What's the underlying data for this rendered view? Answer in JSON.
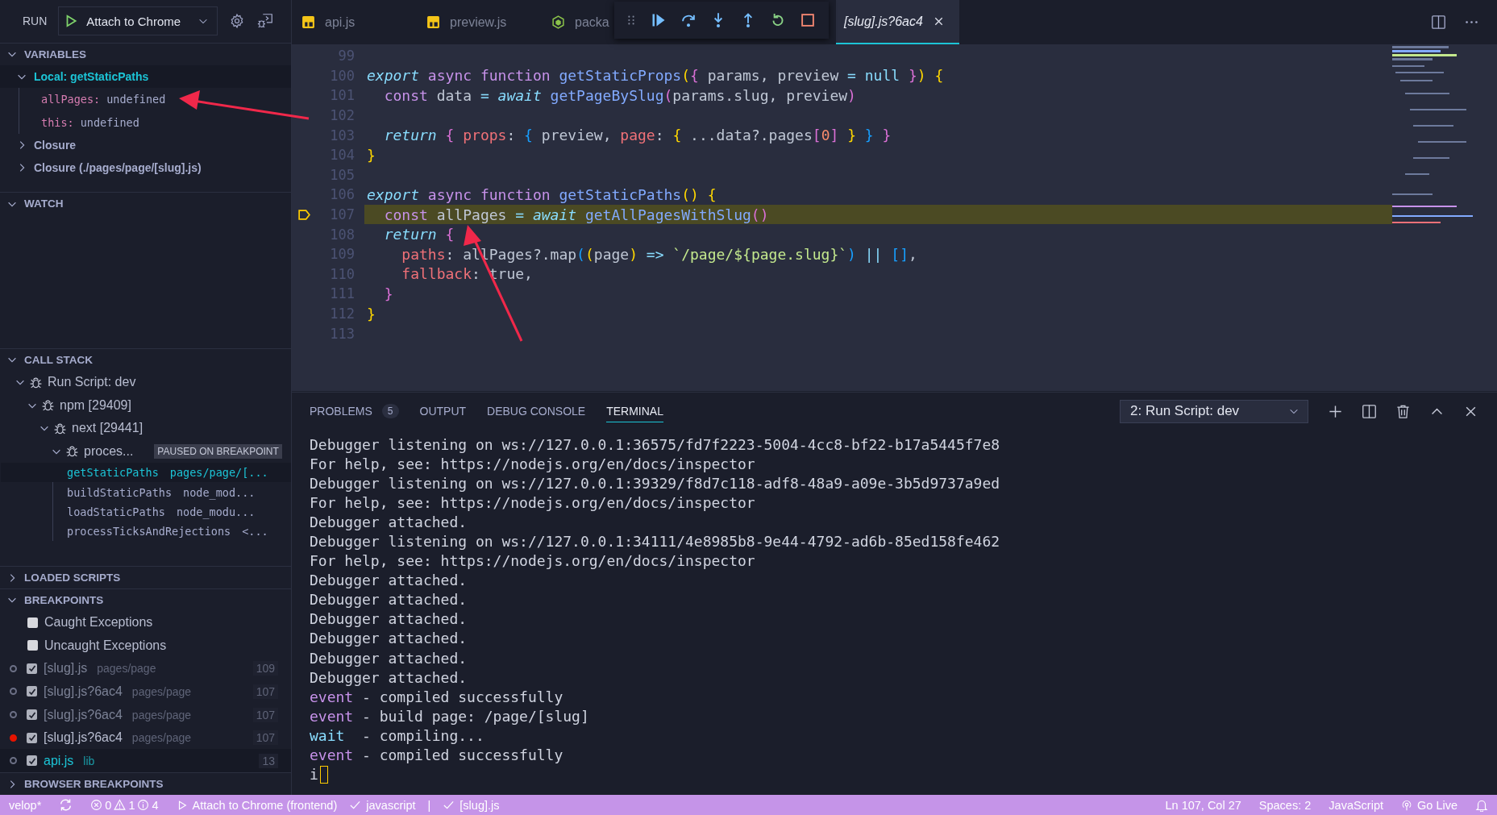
{
  "sidebar": {
    "run": {
      "label": "RUN",
      "configuration": "Attach to Chrome"
    },
    "variables": {
      "title": "VARIABLES",
      "expanded": true,
      "scopes": [
        {
          "label": "Local: getStaticPaths",
          "expanded": true,
          "selected": true,
          "variables": [
            {
              "name": "allPages:",
              "value": "undefined"
            },
            {
              "name": "this:",
              "value": "undefined"
            }
          ]
        },
        {
          "label": "Closure",
          "expanded": false,
          "selected": false
        },
        {
          "label": "Closure (./pages/page/[slug].js)",
          "expanded": false,
          "selected": false
        }
      ]
    },
    "watch": {
      "title": "WATCH",
      "expanded": true
    },
    "call_stack": {
      "title": "CALL STACK",
      "expanded": true,
      "threads": [
        {
          "label": "Run Script: dev",
          "expanded": true,
          "children": [
            {
              "label": "npm [29409]",
              "expanded": true,
              "children": [
                {
                  "label": "next [29441]",
                  "expanded": true,
                  "children": [
                    {
                      "label": "proces...",
                      "badge": "PAUSED ON BREAKPOINT",
                      "expanded": true,
                      "frames": [
                        {
                          "name": "getStaticPaths",
                          "source": "pages/page/[...",
                          "selected": true
                        },
                        {
                          "name": "buildStaticPaths",
                          "source": "node_mod...",
                          "selected": false
                        },
                        {
                          "name": "loadStaticPaths",
                          "source": "node_modu...",
                          "selected": false
                        },
                        {
                          "name": "processTicksAndRejections",
                          "source": "<...",
                          "selected": false
                        }
                      ]
                    }
                  ]
                }
              ]
            }
          ]
        }
      ]
    },
    "loaded_scripts": {
      "title": "LOADED SCRIPTS",
      "expanded": false
    },
    "breakpoints": {
      "title": "BREAKPOINTS",
      "expanded": true,
      "exceptions": [
        {
          "label": "Caught Exceptions",
          "checked": false
        },
        {
          "label": "Uncaught Exceptions",
          "checked": false
        }
      ],
      "files": [
        {
          "file": "[slug].js",
          "path": "pages/page",
          "line": "109",
          "checked": true,
          "verified": false,
          "selected": false
        },
        {
          "file": "[slug].js?6ac4",
          "path": "pages/page",
          "line": "107",
          "checked": true,
          "verified": false,
          "selected": false
        },
        {
          "file": "[slug].js?6ac4",
          "path": "pages/page",
          "line": "107",
          "checked": true,
          "verified": false,
          "selected": false
        },
        {
          "file": "[slug].js?6ac4",
          "path": "pages/page",
          "line": "107",
          "checked": true,
          "verified": true,
          "selected": false
        },
        {
          "file": "api.js",
          "path": "lib",
          "line": "13",
          "checked": true,
          "verified": false,
          "selected": true
        }
      ]
    },
    "browser_breakpoints": {
      "title": "BROWSER BREAKPOINTS",
      "expanded": false
    }
  },
  "editor_tabs": [
    {
      "label": "api.js",
      "kind": "js",
      "selected": false,
      "preview": false
    },
    {
      "label": "preview.js",
      "kind": "js",
      "selected": false,
      "preview": false
    },
    {
      "label": "packa",
      "kind": "node",
      "selected": false,
      "preview": false
    },
    {
      "label": "[slug].js?6ac4",
      "selected": true,
      "preview": true
    }
  ],
  "code_lines": [
    {
      "number": "99",
      "current": false
    },
    {
      "number": "100",
      "current": false,
      "tokens": [
        {
          "text": "export",
          "kind": "kwi"
        },
        {
          "text": " async function",
          "kind": "kw"
        },
        {
          "text": " getStaticProps",
          "kind": "fn"
        },
        {
          "text": "(",
          "kind": "b1"
        },
        {
          "text": "{",
          "kind": "b2"
        },
        {
          "text": " params, preview ",
          "kind": "plain"
        },
        {
          "text": "=",
          "kind": "op"
        },
        {
          "text": " null",
          "kind": "op"
        },
        {
          "text": " }",
          "kind": "b2"
        },
        {
          "text": ")",
          "kind": "b1"
        },
        {
          "text": " {",
          "kind": "b1"
        }
      ]
    },
    {
      "number": "101",
      "current": false,
      "tokens": [
        {
          "text": "  const",
          "kind": "kw"
        },
        {
          "text": " data ",
          "kind": "plain"
        },
        {
          "text": "=",
          "kind": "op"
        },
        {
          "text": " await",
          "kind": "kwi"
        },
        {
          "text": " getPageBySlug",
          "kind": "fn"
        },
        {
          "text": "(",
          "kind": "b2"
        },
        {
          "text": "params.slug, preview",
          "kind": "plain"
        },
        {
          "text": ")",
          "kind": "b2"
        }
      ]
    },
    {
      "number": "102",
      "current": false
    },
    {
      "number": "103",
      "current": false,
      "tokens": [
        {
          "text": "  return",
          "kind": "kwi"
        },
        {
          "text": " {",
          "kind": "b2"
        },
        {
          "text": " props",
          "kind": "prop"
        },
        {
          "text": ": ",
          "kind": "plain"
        },
        {
          "text": "{",
          "kind": "b3"
        },
        {
          "text": " preview, ",
          "kind": "plain"
        },
        {
          "text": "page",
          "kind": "prop"
        },
        {
          "text": ": ",
          "kind": "plain"
        },
        {
          "text": "{",
          "kind": "b1"
        },
        {
          "text": " ...data?.pages",
          "kind": "plain"
        },
        {
          "text": "[",
          "kind": "b2"
        },
        {
          "text": "0",
          "kind": "num"
        },
        {
          "text": "]",
          "kind": "b2"
        },
        {
          "text": " }",
          "kind": "b1"
        },
        {
          "text": " }",
          "kind": "b3"
        },
        {
          "text": " }",
          "kind": "b2"
        }
      ]
    },
    {
      "number": "104",
      "current": false,
      "tokens": [
        {
          "text": "}",
          "kind": "b1"
        }
      ]
    },
    {
      "number": "105",
      "current": false
    },
    {
      "number": "106",
      "current": false,
      "tokens": [
        {
          "text": "export",
          "kind": "kwi"
        },
        {
          "text": " async function",
          "kind": "kw"
        },
        {
          "text": " getStaticPaths",
          "kind": "fn"
        },
        {
          "text": "()",
          "kind": "b1"
        },
        {
          "text": " {",
          "kind": "b1"
        }
      ]
    },
    {
      "number": "107",
      "current": true,
      "tokens": [
        {
          "text": "  const",
          "kind": "kw"
        },
        {
          "text": " allPages ",
          "kind": "plain"
        },
        {
          "text": "=",
          "kind": "op"
        },
        {
          "text": " await",
          "kind": "kwi"
        },
        {
          "text": " getAllPagesWithSlug",
          "kind": "fn"
        },
        {
          "text": "()",
          "kind": "b2"
        }
      ]
    },
    {
      "number": "108",
      "current": false,
      "tokens": [
        {
          "text": "  return",
          "kind": "kwi"
        },
        {
          "text": " {",
          "kind": "b2"
        }
      ]
    },
    {
      "number": "109",
      "current": false,
      "tokens": [
        {
          "text": "    paths",
          "kind": "prop"
        },
        {
          "text": ": allPages?.map",
          "kind": "plain"
        },
        {
          "text": "(",
          "kind": "b3"
        },
        {
          "text": "(",
          "kind": "b1"
        },
        {
          "text": "page",
          "kind": "plain"
        },
        {
          "text": ")",
          "kind": "b1"
        },
        {
          "text": " =>",
          "kind": "op"
        },
        {
          "text": " `/page/${page.slug}`",
          "kind": "str"
        },
        {
          "text": ")",
          "kind": "b3"
        },
        {
          "text": " ||",
          "kind": "op"
        },
        {
          "text": " []",
          "kind": "b3"
        },
        {
          "text": ",",
          "kind": "plain"
        }
      ]
    },
    {
      "number": "110",
      "current": false,
      "tokens": [
        {
          "text": "    fallback",
          "kind": "prop"
        },
        {
          "text": ": ",
          "kind": "plain"
        },
        {
          "text": "true",
          "kind": "plain"
        },
        {
          "text": ",",
          "kind": "plain"
        }
      ]
    },
    {
      "number": "111",
      "current": false,
      "tokens": [
        {
          "text": "  }",
          "kind": "b2"
        }
      ]
    },
    {
      "number": "112",
      "current": false,
      "tokens": [
        {
          "text": "}",
          "kind": "b1"
        }
      ]
    },
    {
      "number": "113",
      "current": false
    }
  ],
  "panel_tabs": [
    {
      "label": "PROBLEMS",
      "badge": "5",
      "selected": false
    },
    {
      "label": "OUTPUT",
      "selected": false
    },
    {
      "label": "DEBUG CONSOLE",
      "selected": false
    },
    {
      "label": "TERMINAL",
      "selected": true
    }
  ],
  "terminal_select": "2: Run Script: dev",
  "terminal_lines": [
    {
      "kind": "plain",
      "text": "Debugger listening on ws://127.0.0.1:36575/fd7f2223-5004-4cc8-bf22-b17a5445f7e8"
    },
    {
      "kind": "plain",
      "text": "For help, see: https://nodejs.org/en/docs/inspector"
    },
    {
      "kind": "plain",
      "text": "Debugger listening on ws://127.0.0.1:39329/f8d7c118-adf8-48a9-a09e-3b5d9737a9ed"
    },
    {
      "kind": "plain",
      "text": "For help, see: https://nodejs.org/en/docs/inspector"
    },
    {
      "kind": "plain",
      "text": "Debugger attached."
    },
    {
      "kind": "plain",
      "text": "Debugger listening on ws://127.0.0.1:34111/4e8985b8-9e44-4792-ad6b-85ed158fe462"
    },
    {
      "kind": "plain",
      "text": "For help, see: https://nodejs.org/en/docs/inspector"
    },
    {
      "kind": "plain",
      "text": "Debugger attached."
    },
    {
      "kind": "plain",
      "text": "Debugger attached."
    },
    {
      "kind": "plain",
      "text": "Debugger attached."
    },
    {
      "kind": "plain",
      "text": "Debugger attached."
    },
    {
      "kind": "plain",
      "text": "Debugger attached."
    },
    {
      "kind": "plain",
      "text": "Debugger attached."
    },
    {
      "kind": "event",
      "tag": "event",
      "text": " - compiled successfully"
    },
    {
      "kind": "event",
      "tag": "event",
      "text": " - build page: /page/[slug]"
    },
    {
      "kind": "wait",
      "tag": "wait",
      "text": "  - compiling..."
    },
    {
      "kind": "event",
      "tag": "event",
      "text": " - compiled successfully"
    },
    {
      "kind": "prompt",
      "text": "i"
    }
  ],
  "status_bar": {
    "left": [
      {
        "kind": "plain",
        "text": "velop*"
      },
      {
        "kind": "sync"
      },
      {
        "kind": "problems",
        "errors": "0",
        "warnings": "1",
        "infos": "4"
      },
      {
        "kind": "launch",
        "text": "Attach to Chrome (frontend)"
      },
      {
        "kind": "check",
        "text": "javascript"
      },
      {
        "kind": "plain",
        "text": "|"
      },
      {
        "kind": "check",
        "text": "[slug].js"
      }
    ],
    "right": [
      {
        "kind": "plain",
        "text": "Ln 107, Col 27"
      },
      {
        "kind": "plain",
        "text": "Spaces: 2"
      },
      {
        "kind": "plain",
        "text": "JavaScript"
      },
      {
        "kind": "golive",
        "text": "Go Live"
      },
      {
        "kind": "bell"
      }
    ]
  }
}
